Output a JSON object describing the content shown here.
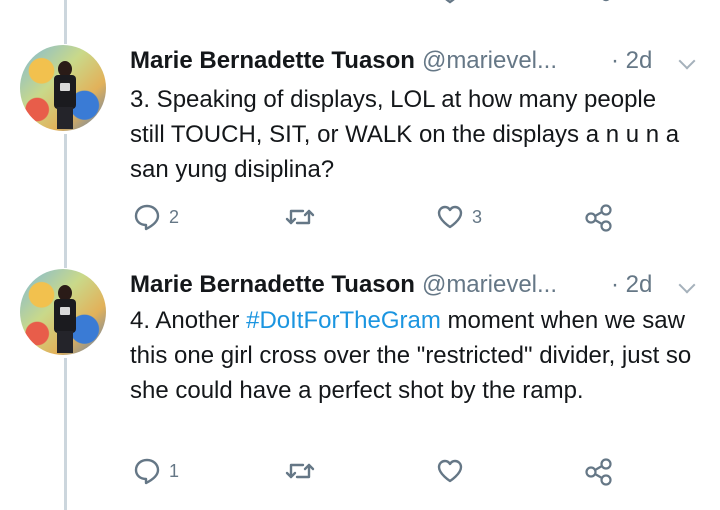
{
  "tweets": [
    {
      "name": "Marie Bernadette Tuason",
      "handle": "@marievel...",
      "time": "· 2d",
      "text_parts": {
        "pre": "3. Speaking of displays, LOL at how many people still TOUCH, SIT, or WALK on the displays a n u n a san yung disiplina?",
        "hashtag": "",
        "post": ""
      },
      "actions": {
        "replies": "2",
        "retweets": "",
        "likes": "3"
      }
    },
    {
      "name": "Marie Bernadette Tuason",
      "handle": "@marievel...",
      "time": "· 2d",
      "text_parts": {
        "pre": "4. Another ",
        "hashtag": "#DoItForTheGram",
        "post": " moment when we saw this one girl cross over the \"restricted\" divider, just so she could have a perfect shot by the ramp."
      },
      "actions": {
        "replies": "1",
        "retweets": "",
        "likes": ""
      }
    }
  ],
  "icons": {
    "reply": "reply-bubble-icon",
    "retweet": "retweet-icon",
    "like": "heart-icon",
    "share": "share-icon",
    "menu": "chevron-down-icon"
  },
  "colors": {
    "text": "#14171a",
    "secondary": "#657786",
    "hashtag": "#1b95e0",
    "icon": "#657786",
    "thread_line": "#ccd6dd"
  }
}
